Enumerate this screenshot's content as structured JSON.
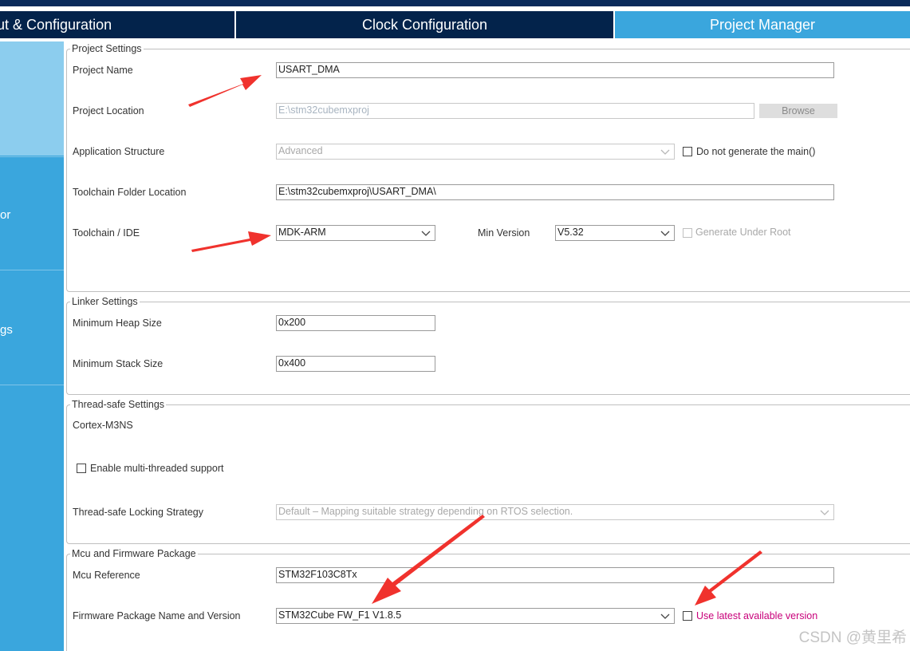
{
  "tabs": [
    {
      "label": "ut & Configuration"
    },
    {
      "label": "Clock Configuration"
    },
    {
      "label": "Project Manager"
    }
  ],
  "sidebar": {
    "items": [
      {
        "label": ""
      },
      {
        "label": "or"
      },
      {
        "label": "gs"
      },
      {
        "label": ""
      }
    ]
  },
  "project_settings": {
    "legend": "Project Settings",
    "project_name_label": "Project Name",
    "project_name_value": "USART_DMA",
    "project_location_label": "Project Location",
    "project_location_value": "E:\\stm32cubemxproj",
    "browse_label": "Browse",
    "app_structure_label": "Application Structure",
    "app_structure_value": "Advanced",
    "do_not_generate_main_label": "Do not generate the main()",
    "toolchain_folder_label": "Toolchain Folder Location",
    "toolchain_folder_value": "E:\\stm32cubemxproj\\USART_DMA\\",
    "toolchain_ide_label": "Toolchain / IDE",
    "toolchain_ide_value": "MDK-ARM",
    "min_version_label": "Min Version",
    "min_version_value": "V5.32",
    "generate_under_root_label": "Generate Under Root"
  },
  "linker_settings": {
    "legend": "Linker Settings",
    "heap_label": "Minimum Heap Size",
    "heap_value": "0x200",
    "stack_label": "Minimum Stack Size",
    "stack_value": "0x400"
  },
  "thread_safe": {
    "legend": "Thread-safe Settings",
    "core_label": "Cortex-M3NS",
    "multithread_label": "Enable multi-threaded support",
    "locking_label": "Thread-safe Locking Strategy",
    "locking_value": "Default  –  Mapping suitable strategy depending on RTOS selection."
  },
  "mcu_firmware": {
    "legend": "Mcu and Firmware Package",
    "mcu_ref_label": "Mcu Reference",
    "mcu_ref_value": "STM32F103C8Tx",
    "fw_label": "Firmware Package Name and Version",
    "fw_value": "STM32Cube FW_F1 V1.8.5",
    "use_latest_label": "Use latest available version"
  },
  "watermark": "CSDN @黄里希",
  "colors": {
    "tab_dark": "#03234b",
    "tab_active": "#3aa6dd",
    "sidebar": "#3aa6dd",
    "sidebar_selected": "#8ccdee",
    "annotation_arrow": "#f0322d",
    "use_latest_text": "#c8007a"
  }
}
